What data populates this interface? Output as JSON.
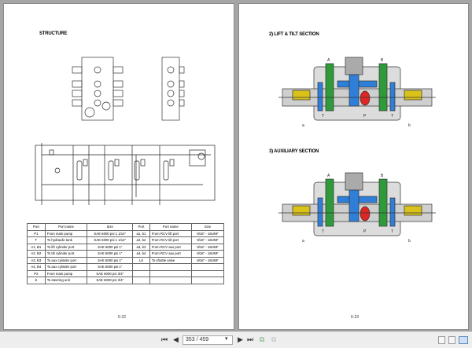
{
  "left_page": {
    "title": "STRUCTURE",
    "page_number": "6-22",
    "table": {
      "headers": [
        "Port",
        "Port name",
        "Size",
        "Port",
        "Port name",
        "Size"
      ],
      "rows": [
        [
          "P1",
          "From main pump",
          "SAE 6000 psi 1 1/14\"",
          "a1, b1",
          "From RCV lift port",
          "9/16\" - 18UNF"
        ],
        [
          "T",
          "To hydraulic tank",
          "SAE 6000 psi 1 1/14\"",
          "a2, b2",
          "From RCV tilt port",
          "9/16\" - 18UNF"
        ],
        [
          "A1, B1",
          "To lift cylinder port",
          "SAE 6000 psi 1\"",
          "a3, b3",
          "From RCV aux port",
          "9/16\" - 18UNF"
        ],
        [
          "A2, B2",
          "To tilt cylinder port",
          "SAE 6000 psi 1\"",
          "a4, b4",
          "From RCV aux port",
          "9/16\" - 18UNF"
        ],
        [
          "A3, B3",
          "To aux cylinder port",
          "SAE 6000 psi 1\"",
          "LS",
          "To shuttle valve",
          "9/16\" - 18UNF"
        ],
        [
          "A4, B4",
          "To aux cylinder port",
          "SAE 6000 psi 1\"",
          "",
          "",
          ""
        ],
        [
          "P2",
          "From main pump",
          "SAE 6000 psi 3/4\"",
          "",
          "",
          ""
        ],
        [
          "S",
          "To steering unit",
          "SAE 6000 psi 3/4\"",
          "",
          "",
          ""
        ]
      ]
    }
  },
  "right_page": {
    "section1_title": "2) LIFT & TILT SECTION",
    "section2_title": "3) AUXILIARY SECTION",
    "page_number": "6-23",
    "labels": {
      "A": "A",
      "B": "B",
      "T": "T",
      "P": "P",
      "a": "a",
      "b": "b"
    }
  },
  "toolbar": {
    "page_indicator": "353 / 459",
    "icons": [
      "first-page-icon",
      "prev-page-icon",
      "next-page-icon",
      "last-page-icon",
      "fit-page-icon",
      "fit-width-icon",
      "single-page-icon",
      "continuous-page-icon",
      "two-page-icon"
    ]
  },
  "colors": {
    "green": "#2e9a3a",
    "blue": "#2f7fd8",
    "red": "#e02525",
    "yellow": "#d9c21a",
    "body": "#dcdcdc"
  }
}
